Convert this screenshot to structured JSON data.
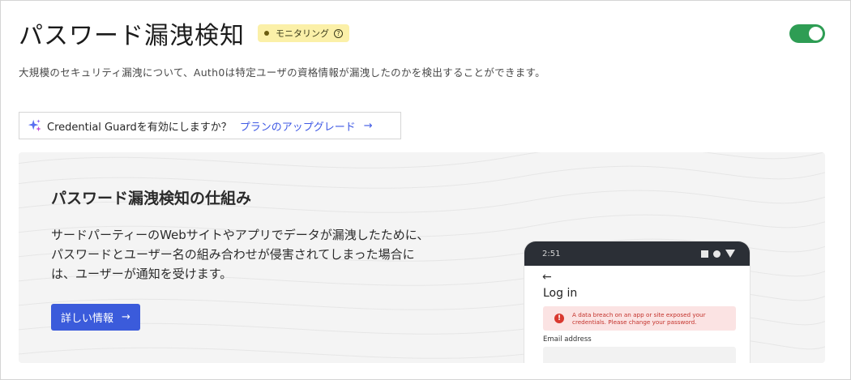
{
  "header": {
    "title": "パスワード漏洩検知",
    "badge_label": "モニタリング",
    "badge_help_glyph": "?",
    "toggle_on": true
  },
  "description": "大規模のセキュリティ漏洩について、Auth0は特定ユーザの資格情報が漏洩したのかを検出することができます。",
  "upgrade": {
    "question": "Credential Guardを有効にしますか？",
    "link_label": "プランのアップグレード",
    "arrow": "→",
    "icon": "sparkle-icon"
  },
  "how_it_works": {
    "title": "パスワード漏洩検知の仕組み",
    "body": "サードパーティーのWebサイトやアプリでデータが漏洩したために、パスワードとユーザー名の組み合わせが侵害されてしまった場合には、ユーザーが通知を受けます。",
    "button_label": "詳しい情報",
    "button_arrow": "→"
  },
  "phone": {
    "time": "2:51",
    "back_arrow": "←",
    "login_title": "Log in",
    "alert_icon_glyph": "!",
    "alert_text": "A data breach on an app or site exposed your credentials. Please change your password.",
    "email_label": "Email address"
  },
  "colors": {
    "accent": "#3b5bdb",
    "toggle": "#2e9d54",
    "badge": "#fbf0a8",
    "alert_bg": "#fbe3e3",
    "alert_text": "#c3322b"
  }
}
